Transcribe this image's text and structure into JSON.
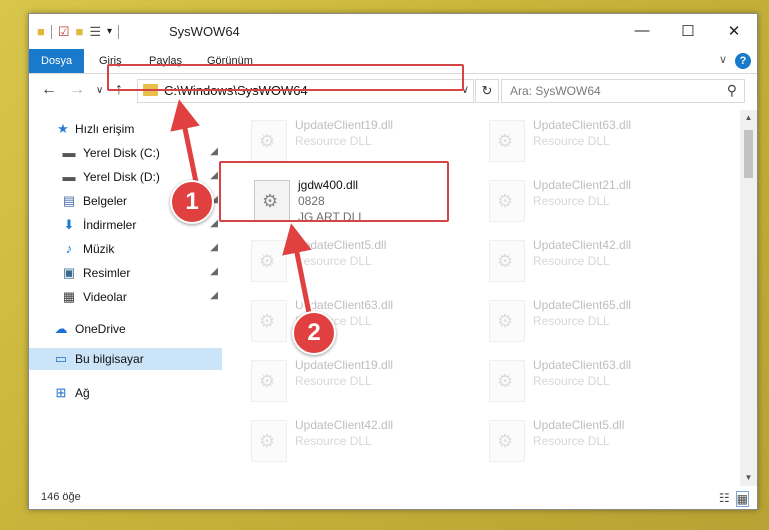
{
  "window": {
    "title": "SysWOW64",
    "controls": {
      "minimize": "—",
      "maximize": "☐",
      "close": "✕"
    }
  },
  "ribbon": {
    "tabs": [
      "Dosya",
      "Giriş",
      "Paylaş",
      "Görünüm"
    ],
    "active_tab": "Dosya",
    "help": "?",
    "expand": "∨"
  },
  "navbar": {
    "back": "←",
    "forward": "→",
    "recent": "∨",
    "up": "↑",
    "address": "C:\\Windows\\SysWOW64",
    "address_dropdown": "∨",
    "refresh": "↻",
    "search_placeholder": "Ara: SysWOW64",
    "search_icon": "⚲"
  },
  "sidebar": {
    "items": [
      {
        "label": "Hızlı erişim",
        "icon": "star-icon",
        "glyph": "★",
        "color": "#2b7cd3",
        "pinned": false
      },
      {
        "label": "Yerel Disk (C:)",
        "icon": "drive-icon",
        "glyph": "▬",
        "color": "#555555",
        "pinned": true
      },
      {
        "label": "Yerel Disk (D:)",
        "icon": "drive-icon",
        "glyph": "▬",
        "color": "#555555",
        "pinned": true
      },
      {
        "label": "Belgeler",
        "icon": "documents-icon",
        "glyph": "▤",
        "color": "#4a6ea8",
        "pinned": true
      },
      {
        "label": "İndirmeler",
        "icon": "download-icon",
        "glyph": "⬇",
        "color": "#1d7ad1",
        "pinned": true
      },
      {
        "label": "Müzik",
        "icon": "music-icon",
        "glyph": "♪",
        "color": "#1d7ad1",
        "pinned": true
      },
      {
        "label": "Resimler",
        "icon": "pictures-icon",
        "glyph": "▣",
        "color": "#3d6a8a",
        "pinned": true
      },
      {
        "label": "Videolar",
        "icon": "videos-icon",
        "glyph": "▦",
        "color": "#3b3b3b",
        "pinned": true
      },
      {
        "label": "OneDrive",
        "icon": "cloud-icon",
        "glyph": "☁",
        "color": "#1b6fd0",
        "pinned": false
      },
      {
        "label": "Bu bilgisayar",
        "icon": "computer-icon",
        "glyph": "▭",
        "color": "#1b6fd0",
        "pinned": false
      },
      {
        "label": "Ağ",
        "icon": "network-icon",
        "glyph": "⊞",
        "color": "#1b6fd0",
        "pinned": false
      }
    ],
    "selected": "Bu bilgisayar",
    "pin_glyph": "📌"
  },
  "files": [
    {
      "name": "UpdateClient19.dll",
      "desc": "Resource DLL",
      "desc2": "",
      "faded": true
    },
    {
      "name": "UpdateClient63.dll",
      "desc": "Resource DLL",
      "desc2": "",
      "faded": true
    },
    {
      "name": "jgdw400.dll",
      "desc": "0828",
      "desc2": "JG ART DLL",
      "faded": false
    },
    {
      "name": "UpdateClient21.dll",
      "desc": "Resource DLL",
      "desc2": "",
      "faded": true
    },
    {
      "name": "UpdateClient5.dll",
      "desc": "Resource DLL",
      "desc2": "",
      "faded": true
    },
    {
      "name": "UpdateClient42.dll",
      "desc": "Resource DLL",
      "desc2": "",
      "faded": true
    },
    {
      "name": "UpdateClient63.dll",
      "desc": "Resource DLL",
      "desc2": "",
      "faded": true
    },
    {
      "name": "UpdateClient65.dll",
      "desc": "Resource DLL",
      "desc2": "",
      "faded": true
    },
    {
      "name": "UpdateClient19.dll",
      "desc": "Resource DLL",
      "desc2": "",
      "faded": true
    },
    {
      "name": "UpdateClient63.dll",
      "desc": "Resource DLL",
      "desc2": "",
      "faded": true
    },
    {
      "name": "UpdateClient42.dll",
      "desc": "Resource DLL",
      "desc2": "",
      "faded": true
    },
    {
      "name": "UpdateClient5.dll",
      "desc": "Resource DLL",
      "desc2": "",
      "faded": true
    }
  ],
  "status": {
    "count": "146 öğe",
    "view_details": "☷",
    "view_tiles": "▦"
  },
  "callouts": [
    "1",
    "2"
  ],
  "highlight_color": "#d64545"
}
